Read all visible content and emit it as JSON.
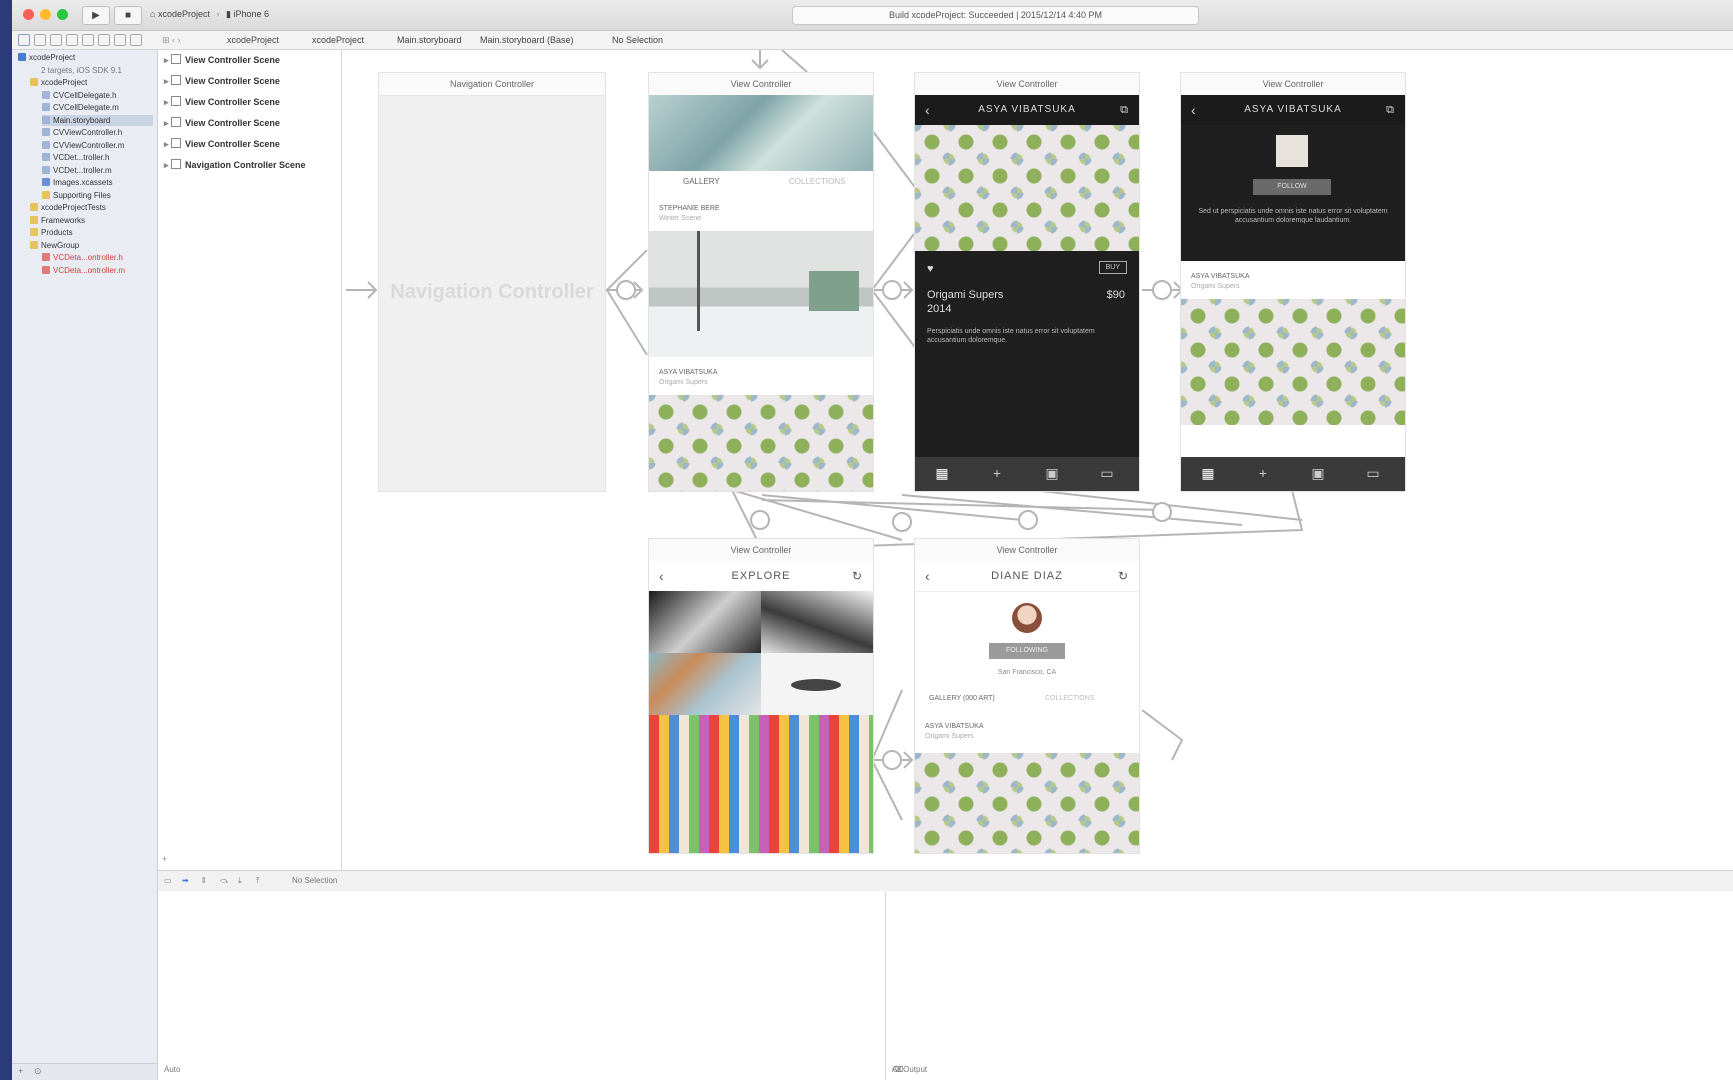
{
  "titlebar": {
    "scheme_project": "xcodeProject",
    "scheme_device": "iPhone 6",
    "activity": "Build xcodeProject: Succeeded | 2015/12/14 4:40 PM"
  },
  "jumpbar": {
    "crumbs": [
      "xcodeProject",
      "xcodeProject",
      "Main.storyboard",
      "Main.storyboard (Base)",
      "No Selection"
    ]
  },
  "navigator": {
    "items": [
      {
        "label": "xcodeProject",
        "indent": 0,
        "type": "project"
      },
      {
        "label": "2 targets, iOS SDK 9.1",
        "indent": 1,
        "type": "meta"
      },
      {
        "label": "xcodeProject",
        "indent": 1,
        "type": "folder"
      },
      {
        "label": "CVCellDelegate.h",
        "indent": 2,
        "type": "file"
      },
      {
        "label": "CVCellDelegate.m",
        "indent": 2,
        "type": "file"
      },
      {
        "label": "Main.storyboard",
        "indent": 2,
        "type": "file",
        "selected": true
      },
      {
        "label": "CVViewController.h",
        "indent": 2,
        "type": "file"
      },
      {
        "label": "CVViewController.m",
        "indent": 2,
        "type": "file"
      },
      {
        "label": "VCDet...troller.h",
        "indent": 2,
        "type": "file"
      },
      {
        "label": "VCDet...troller.m",
        "indent": 2,
        "type": "file"
      },
      {
        "label": "Images.xcassets",
        "indent": 2,
        "type": "asset"
      },
      {
        "label": "Supporting Files",
        "indent": 2,
        "type": "folder"
      },
      {
        "label": "xcodeProjectTests",
        "indent": 1,
        "type": "folder"
      },
      {
        "label": "Frameworks",
        "indent": 1,
        "type": "folder"
      },
      {
        "label": "Products",
        "indent": 1,
        "type": "folder"
      },
      {
        "label": "NewGroup",
        "indent": 1,
        "type": "folder"
      },
      {
        "label": "VCDeta...ontroller.h",
        "indent": 2,
        "type": "missing"
      },
      {
        "label": "VCDeta...ontroller.m",
        "indent": 2,
        "type": "missing"
      }
    ]
  },
  "outline": {
    "items": [
      "View Controller Scene",
      "View Controller Scene",
      "View Controller Scene",
      "View Controller Scene",
      "View Controller Scene",
      "Navigation Controller Scene"
    ]
  },
  "canvas": {
    "nav_scene_title": "Navigation Controller",
    "nav_placeholder": "Navigation Controller",
    "vc_title": "View Controller",
    "gallery": {
      "tab1": "GALLERY",
      "tab2": "COLLECTIONS",
      "card1_name": "STEPHANIE BERE",
      "card1_sub": "Winter Scene",
      "card2_name": "ASYA VIBATSUKA",
      "card2_sub": "Origami Supers"
    },
    "detail": {
      "header": "ASYA VIBATSUKA",
      "item_title": "Origami Supers",
      "item_year": "2014",
      "price": "$90",
      "buy_label": "BUY",
      "desc": "Perspiciatis unde omnis iste natus error sit voluptatem accusantium doloremque."
    },
    "profile": {
      "header": "ASYA VIBATSUKA",
      "follow_label": "FOLLOW",
      "bio": "Sed ut perspiciatis unde omnis iste natus error sit voluptatem accusantium doloremque laudantium.",
      "card_name": "ASYA VIBATSUKA",
      "card_sub": "Origami Supers"
    },
    "explore": {
      "header": "EXPLORE"
    },
    "artist": {
      "header": "DIANE DIAZ",
      "follow_label": "FOLLOWING",
      "location": "San Francisco, CA",
      "left_tab": "GALLERY (000 ART)",
      "right_tab": "COLLECTIONS",
      "card_name": "ASYA VIBATSUKA",
      "card_sub": "Origami Supers"
    }
  },
  "debug": {
    "auto_label": "Auto",
    "output_label": "All Output",
    "selection": "No Selection"
  },
  "colors": {
    "desktop": "#2b3a78",
    "dark_screen": "#1f1f1f",
    "tabbar": "#3a3a3a",
    "selected_row": "#c9d3e2"
  }
}
